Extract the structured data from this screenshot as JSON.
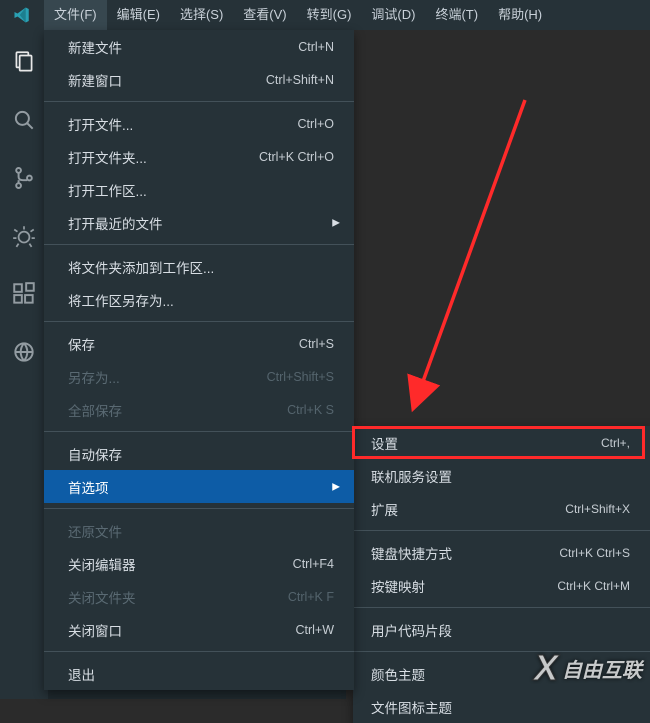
{
  "menubar": {
    "items": [
      {
        "label": "文件(F)",
        "open": true
      },
      {
        "label": "编辑(E)"
      },
      {
        "label": "选择(S)"
      },
      {
        "label": "查看(V)"
      },
      {
        "label": "转到(G)"
      },
      {
        "label": "调试(D)"
      },
      {
        "label": "终端(T)"
      },
      {
        "label": "帮助(H)"
      }
    ]
  },
  "file_menu": [
    {
      "label": "新建文件",
      "shortcut": "Ctrl+N"
    },
    {
      "label": "新建窗口",
      "shortcut": "Ctrl+Shift+N"
    },
    {
      "type": "sep"
    },
    {
      "label": "打开文件...",
      "shortcut": "Ctrl+O"
    },
    {
      "label": "打开文件夹...",
      "shortcut": "Ctrl+K Ctrl+O"
    },
    {
      "label": "打开工作区..."
    },
    {
      "label": "打开最近的文件",
      "submenu": true
    },
    {
      "type": "sep"
    },
    {
      "label": "将文件夹添加到工作区..."
    },
    {
      "label": "将工作区另存为..."
    },
    {
      "type": "sep"
    },
    {
      "label": "保存",
      "shortcut": "Ctrl+S"
    },
    {
      "label": "另存为...",
      "shortcut": "Ctrl+Shift+S",
      "disabled": true
    },
    {
      "label": "全部保存",
      "shortcut": "Ctrl+K S",
      "disabled": true
    },
    {
      "type": "sep"
    },
    {
      "label": "自动保存"
    },
    {
      "label": "首选项",
      "submenu": true,
      "hover": true
    },
    {
      "type": "sep"
    },
    {
      "label": "还原文件",
      "disabled": true
    },
    {
      "label": "关闭编辑器",
      "shortcut": "Ctrl+F4"
    },
    {
      "label": "关闭文件夹",
      "shortcut": "Ctrl+K F",
      "disabled": true
    },
    {
      "label": "关闭窗口",
      "shortcut": "Ctrl+W"
    },
    {
      "type": "sep"
    },
    {
      "label": "退出"
    }
  ],
  "pref_submenu": [
    {
      "label": "设置",
      "shortcut": "Ctrl+,"
    },
    {
      "label": "联机服务设置"
    },
    {
      "label": "扩展",
      "shortcut": "Ctrl+Shift+X"
    },
    {
      "type": "sep"
    },
    {
      "label": "键盘快捷方式",
      "shortcut": "Ctrl+K Ctrl+S"
    },
    {
      "label": "按键映射",
      "shortcut": "Ctrl+K Ctrl+M"
    },
    {
      "type": "sep"
    },
    {
      "label": "用户代码片段"
    },
    {
      "type": "sep"
    },
    {
      "label": "颜色主题"
    },
    {
      "label": "文件图标主题"
    }
  ],
  "watermark": "自由互联"
}
